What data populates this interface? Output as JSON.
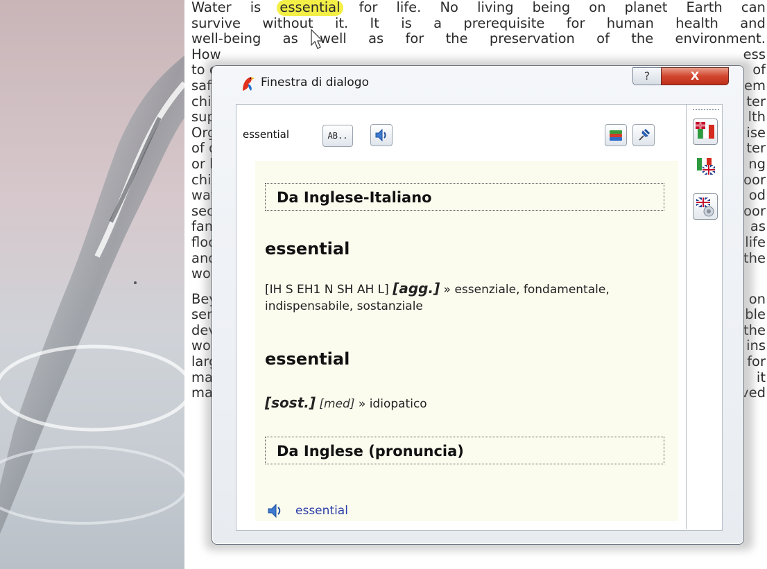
{
  "article": {
    "lines_top": [
      [
        "Water",
        "is",
        "HL:essential",
        "for",
        "life.",
        "No",
        "living",
        "being",
        "on",
        "planet",
        "Earth",
        "can"
      ],
      [
        "survive",
        "without",
        "it.",
        "It",
        "is",
        "a",
        "prerequisite",
        "for",
        "human",
        "health",
        "and"
      ],
      [
        "well-being",
        "as",
        "well",
        "as",
        "for",
        "the",
        "preservation",
        "of",
        "the",
        "environment."
      ]
    ],
    "left_fragments": [
      "How",
      "to e",
      "safe",
      "child",
      "supp",
      "Orga",
      "of di",
      "or h",
      "child",
      "wate",
      "secu",
      "fami",
      "flood",
      "and",
      "worl"
    ],
    "right_fragments": [
      "ess",
      "of",
      "em",
      "ter",
      "lth",
      "ise",
      "ter",
      "ng",
      "oor",
      "od",
      "oor",
      "as",
      "life",
      "the",
      ""
    ],
    "left_fragments2": [
      "Beyo",
      "serv",
      "deve",
      "worl",
      "large",
      "man"
    ],
    "right_fragments2": [
      "on",
      "ble",
      "the",
      "ins",
      "for",
      "it"
    ],
    "last_line": "makes up an integral part of transport systems. With improved"
  },
  "dialog": {
    "title": "Finestra di dialogo",
    "help_label": "?",
    "close_label": "X",
    "lookup_word": "essential",
    "ab_label": "AB..",
    "sections": [
      {
        "heading": "Da Inglese-Italiano"
      },
      {
        "heading": "Da Inglese (pronuncia)"
      }
    ],
    "entry1": {
      "word": "essential",
      "phonetic": "[IH S EH1 N SH AH L]",
      "pos": "[agg.]",
      "arrow": "»",
      "meaning": "essenziale, fondamentale, indispensabile, sostanziale"
    },
    "entry2": {
      "word": "essential",
      "pos": "[sost.]",
      "field": "[med]",
      "arrow": "»",
      "meaning": "idiopatico"
    },
    "pronunciation_word": "essential"
  },
  "colors": {
    "highlight": "#f3ef46",
    "close_red": "#c8381f",
    "content_bg": "#fbfbee",
    "link_blue": "#2b3fa8"
  }
}
